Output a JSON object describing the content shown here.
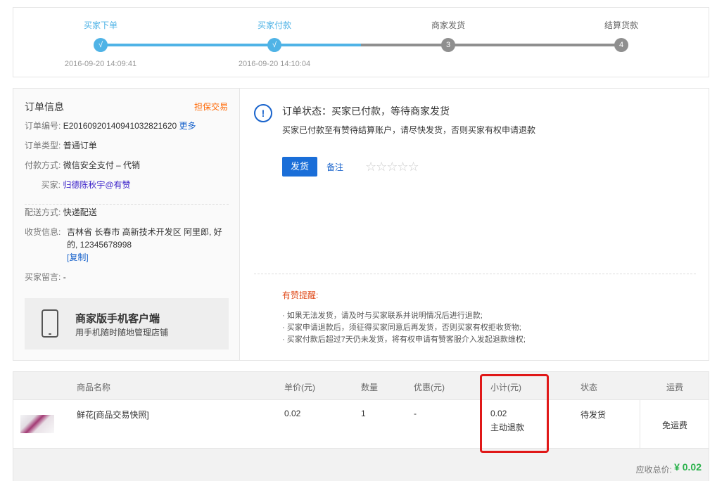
{
  "progress": {
    "steps": [
      {
        "label": "买家下单",
        "time": "2016-09-20 14:09:41",
        "mark": "√"
      },
      {
        "label": "买家付款",
        "time": "2016-09-20 14:10:04",
        "mark": "√"
      },
      {
        "label": "商家发货",
        "time": "",
        "mark": "3"
      },
      {
        "label": "结算货款",
        "time": "",
        "mark": "4"
      }
    ],
    "done_color": "#4fb3e6",
    "todo_color": "#8f8f8f"
  },
  "order_info": {
    "title": "订单信息",
    "badge": "担保交易",
    "number_label": "订单编号:",
    "number": "E20160920140941032821620",
    "more_link": "更多",
    "type_label": "订单类型:",
    "type": "普通订单",
    "payment_label": "付款方式:",
    "payment": "微信安全支付 – 代销",
    "buyer_label": "买家:",
    "buyer": "归德陈秋宇@有赞",
    "delivery_label": "配送方式:",
    "delivery": "快递配送",
    "address_label": "收货信息:",
    "address": "吉林省 长春市 高新技术开发区 阿里郎, 好的, 12345678998",
    "copy_link": "[复制]",
    "message_label": "买家留言:",
    "message": "-"
  },
  "mobile_promo": {
    "title": "商家版手机客户端",
    "subtitle": "用手机随时随地管理店铺"
  },
  "status": {
    "icon": "!",
    "title": "订单状态：买家已付款，等待商家发货",
    "description": "买家已付款至有赞待结算账户，请尽快发货，否则买家有权申请退款",
    "ship_button": "发货",
    "note_link": "备注",
    "stars": "☆☆☆☆☆"
  },
  "tips": {
    "title": "有赞提醒:",
    "items": [
      "· 如果无法发货，请及时与买家联系并说明情况后进行退款;",
      "· 买家申请退款后，须征得买家同意后再发货，否则买家有权拒收货物;",
      "· 买家付款后超过7天仍未发货，将有权申请有赞客服介入发起退款维权;"
    ]
  },
  "goods": {
    "headers": {
      "name": "商品名称",
      "price": "单价(元)",
      "qty": "数量",
      "discount": "优惠(元)",
      "subtotal": "小计(元)",
      "status": "状态",
      "shipping": "运费"
    },
    "row": {
      "name": "鲜花[商品交易快照]",
      "price": "0.02",
      "qty": "1",
      "discount": "-",
      "subtotal": "0.02",
      "refund_link": "主动退款",
      "status": "待发货",
      "shipping": "免运费"
    },
    "total_label": "应收总价:",
    "total_value": "¥ 0.02"
  }
}
